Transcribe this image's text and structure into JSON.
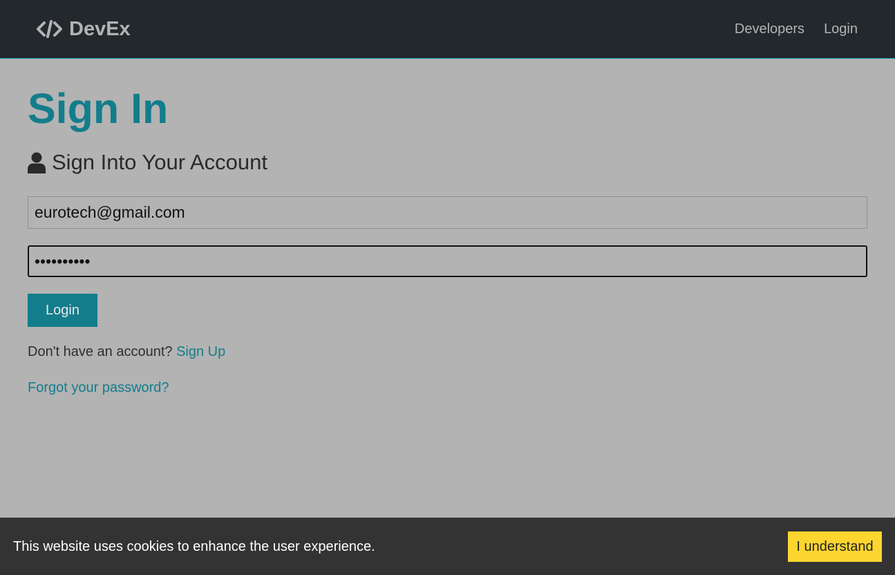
{
  "navbar": {
    "brand_text": "DevEx",
    "links": [
      "Developers",
      "Login"
    ]
  },
  "main": {
    "title": "Sign In",
    "lead": "Sign Into Your Account",
    "email_value": "eurotech@gmail.com",
    "password_value": "••••••••••",
    "login_button": "Login",
    "signup_prompt": "Don't have an account?",
    "signup_link": "Sign Up",
    "forgot_link": "Forgot your password?"
  },
  "cookie_banner": {
    "text": "This website uses cookies to enhance the user experience.",
    "button": "I understand"
  },
  "colors": {
    "navbar_bg": "#23282d",
    "page_bg": "#b3b3b3",
    "accent": "#137d8c",
    "cookie_bg": "#333333",
    "cookie_button": "#fdd52f"
  },
  "icons": {
    "brand": "code-icon",
    "lead": "user-icon"
  }
}
